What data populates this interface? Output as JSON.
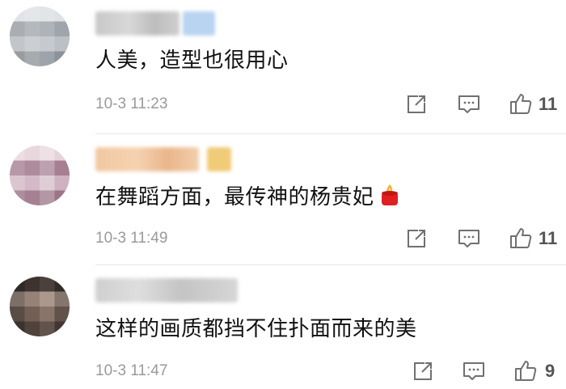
{
  "comments": [
    {
      "text": "人美，造型也很用心",
      "time": "10-3 11:23",
      "likes": "11",
      "has_candle_emoji": false
    },
    {
      "text": "在舞蹈方面，最传神的杨贵妃",
      "time": "10-3 11:49",
      "likes": "11",
      "has_candle_emoji": true
    },
    {
      "text": "这样的画质都挡不住扑面而来的美",
      "time": "10-3 11:47",
      "likes": "9",
      "has_candle_emoji": false
    }
  ],
  "icons": {
    "share": "share-icon",
    "comment": "comment-icon",
    "like": "thumbs-up-icon",
    "emoji": "candle-emoji"
  },
  "colors": {
    "text": "#111111",
    "meta": "#9a9a9a",
    "icon": "#707070",
    "divider": "#e6e6e6"
  }
}
